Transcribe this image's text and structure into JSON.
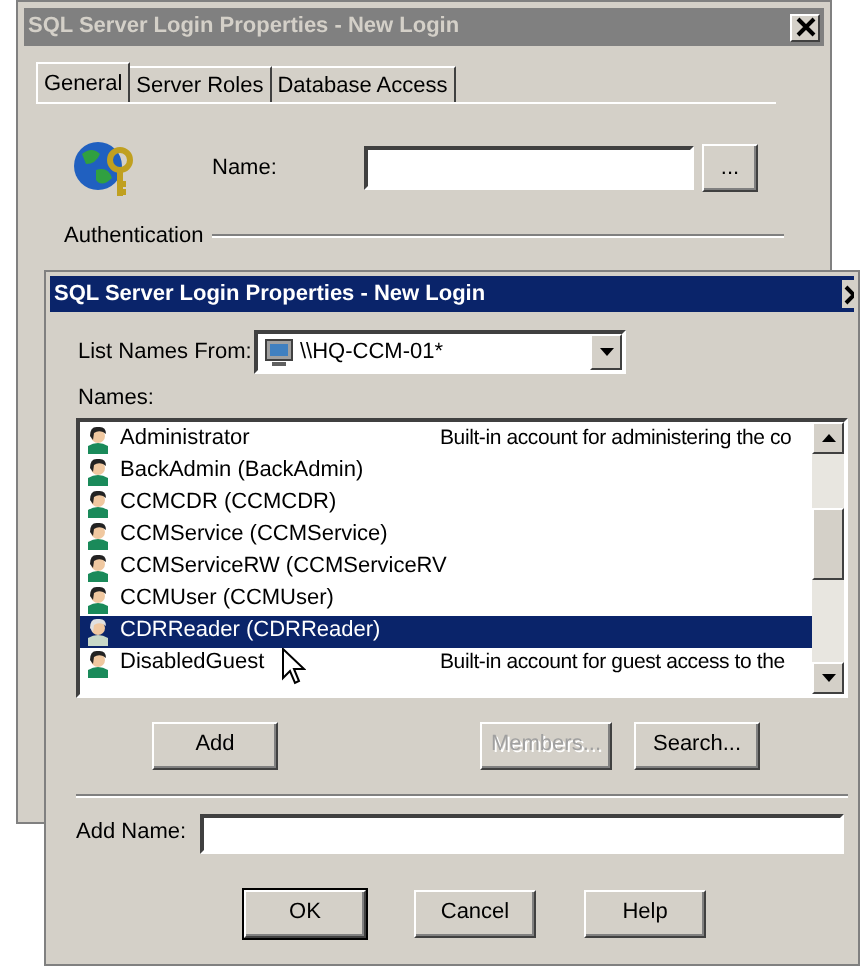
{
  "back_dialog": {
    "title": "SQL Server Login Properties - New Login",
    "tabs": [
      {
        "label": "General",
        "selected": true
      },
      {
        "label": "Server Roles",
        "selected": false
      },
      {
        "label": "Database Access",
        "selected": false
      }
    ],
    "name_label": "Name:",
    "browse_button": "...",
    "group_label": "Authentication"
  },
  "front_dialog": {
    "title": "SQL Server Login Properties - New Login",
    "list_names_from": {
      "label": "List Names From:",
      "value": "\\\\HQ-CCM-01*"
    },
    "names_label": "Names:",
    "names": [
      {
        "name": "Administrator",
        "description": "Built-in account for administering the co",
        "selected": false
      },
      {
        "name": "BackAdmin (BackAdmin)",
        "selected": false
      },
      {
        "name": "CCMCDR (CCMCDR)",
        "selected": false
      },
      {
        "name": "CCMService (CCMService)",
        "selected": false
      },
      {
        "name": "CCMServiceRW (CCMServiceRV",
        "selected": false
      },
      {
        "name": "CCMUser (CCMUser)",
        "selected": false
      },
      {
        "name": "CDRReader (CDRReader)",
        "selected": true
      },
      {
        "name": "DisabledGuest",
        "description": "Built-in account for guest access to the",
        "selected": false
      }
    ],
    "list_buttons": [
      {
        "label": "Add",
        "disabled": false
      },
      {
        "label": "Members...",
        "disabled": true
      },
      {
        "label": "Search...",
        "disabled": false
      }
    ],
    "add_name_label": "Add Name:",
    "buttons": [
      "OK",
      "Cancel",
      "Help"
    ]
  }
}
